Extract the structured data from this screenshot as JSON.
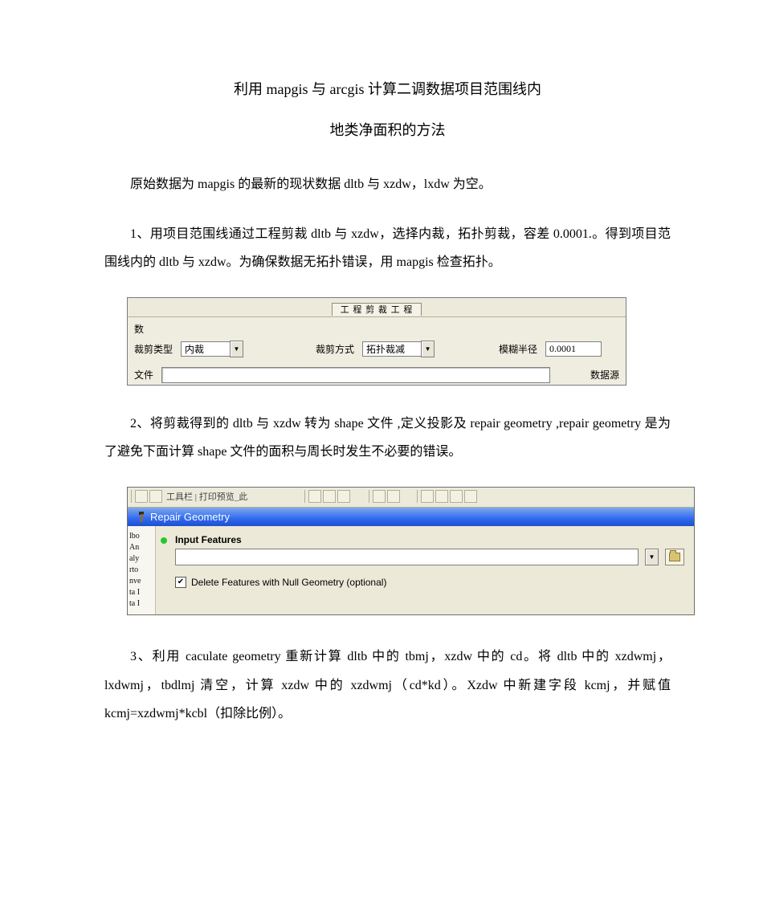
{
  "title": "利用 mapgis 与 arcgis 计算二调数据项目范围线内",
  "subtitle": "地类净面积的方法",
  "p_intro": "原始数据为 mapgis 的最新的现状数据 dltb 与 xzdw，lxdw 为空。",
  "p1": "1、用项目范围线通过工程剪裁 dltb 与 xzdw，选择内裁，拓扑剪裁，容差 0.0001.。得到项目范围线内的 dltb 与 xzdw。为确保数据无拓扑错误，用 mapgis 检查拓扑。",
  "p2": "2、将剪裁得到的 dltb 与 xzdw 转为 shape 文件 ,定义投影及 repair  geometry ,repair geometry 是为了避免下面计算 shape 文件的面积与周长时发生不必要的错误。",
  "p3": "3、利用 caculate  geometry 重新计算 dltb 中的 tbmj，xzdw 中的 cd。将 dltb 中的 xzdwmj，lxdwmj，tbdlmj 清空，计算 xzdw 中的 xzdwmj（cd*kd）。Xzdw 中新建字段 kcmj，并赋值 kcmj=xzdwmj*kcbl（扣除比例）。",
  "fig1": {
    "header_btn": "工 程 剪 裁 工 程",
    "param_label_top": "数",
    "clip_type_label": "裁剪类型",
    "clip_type_value": "内裁",
    "clip_mode_label": "裁剪方式",
    "clip_mode_value": "拓扑裁减",
    "fuzzy_label": "模糊半径",
    "fuzzy_value": "0.0001",
    "file_label": "文件",
    "datasource_label": "数据源"
  },
  "fig2": {
    "toolbar_text": "工具栏  |  打印预览_此",
    "window_title": "Repair Geometry",
    "input_label": "Input Features",
    "dropdown_glyph": "▼",
    "checkbox_checked": "✔",
    "checkbox_label": "Delete Features with Null Geometry (optional)",
    "tree": [
      "lbo",
      "An",
      "aly",
      "rto",
      "nve",
      "ta I",
      "ta I"
    ]
  }
}
